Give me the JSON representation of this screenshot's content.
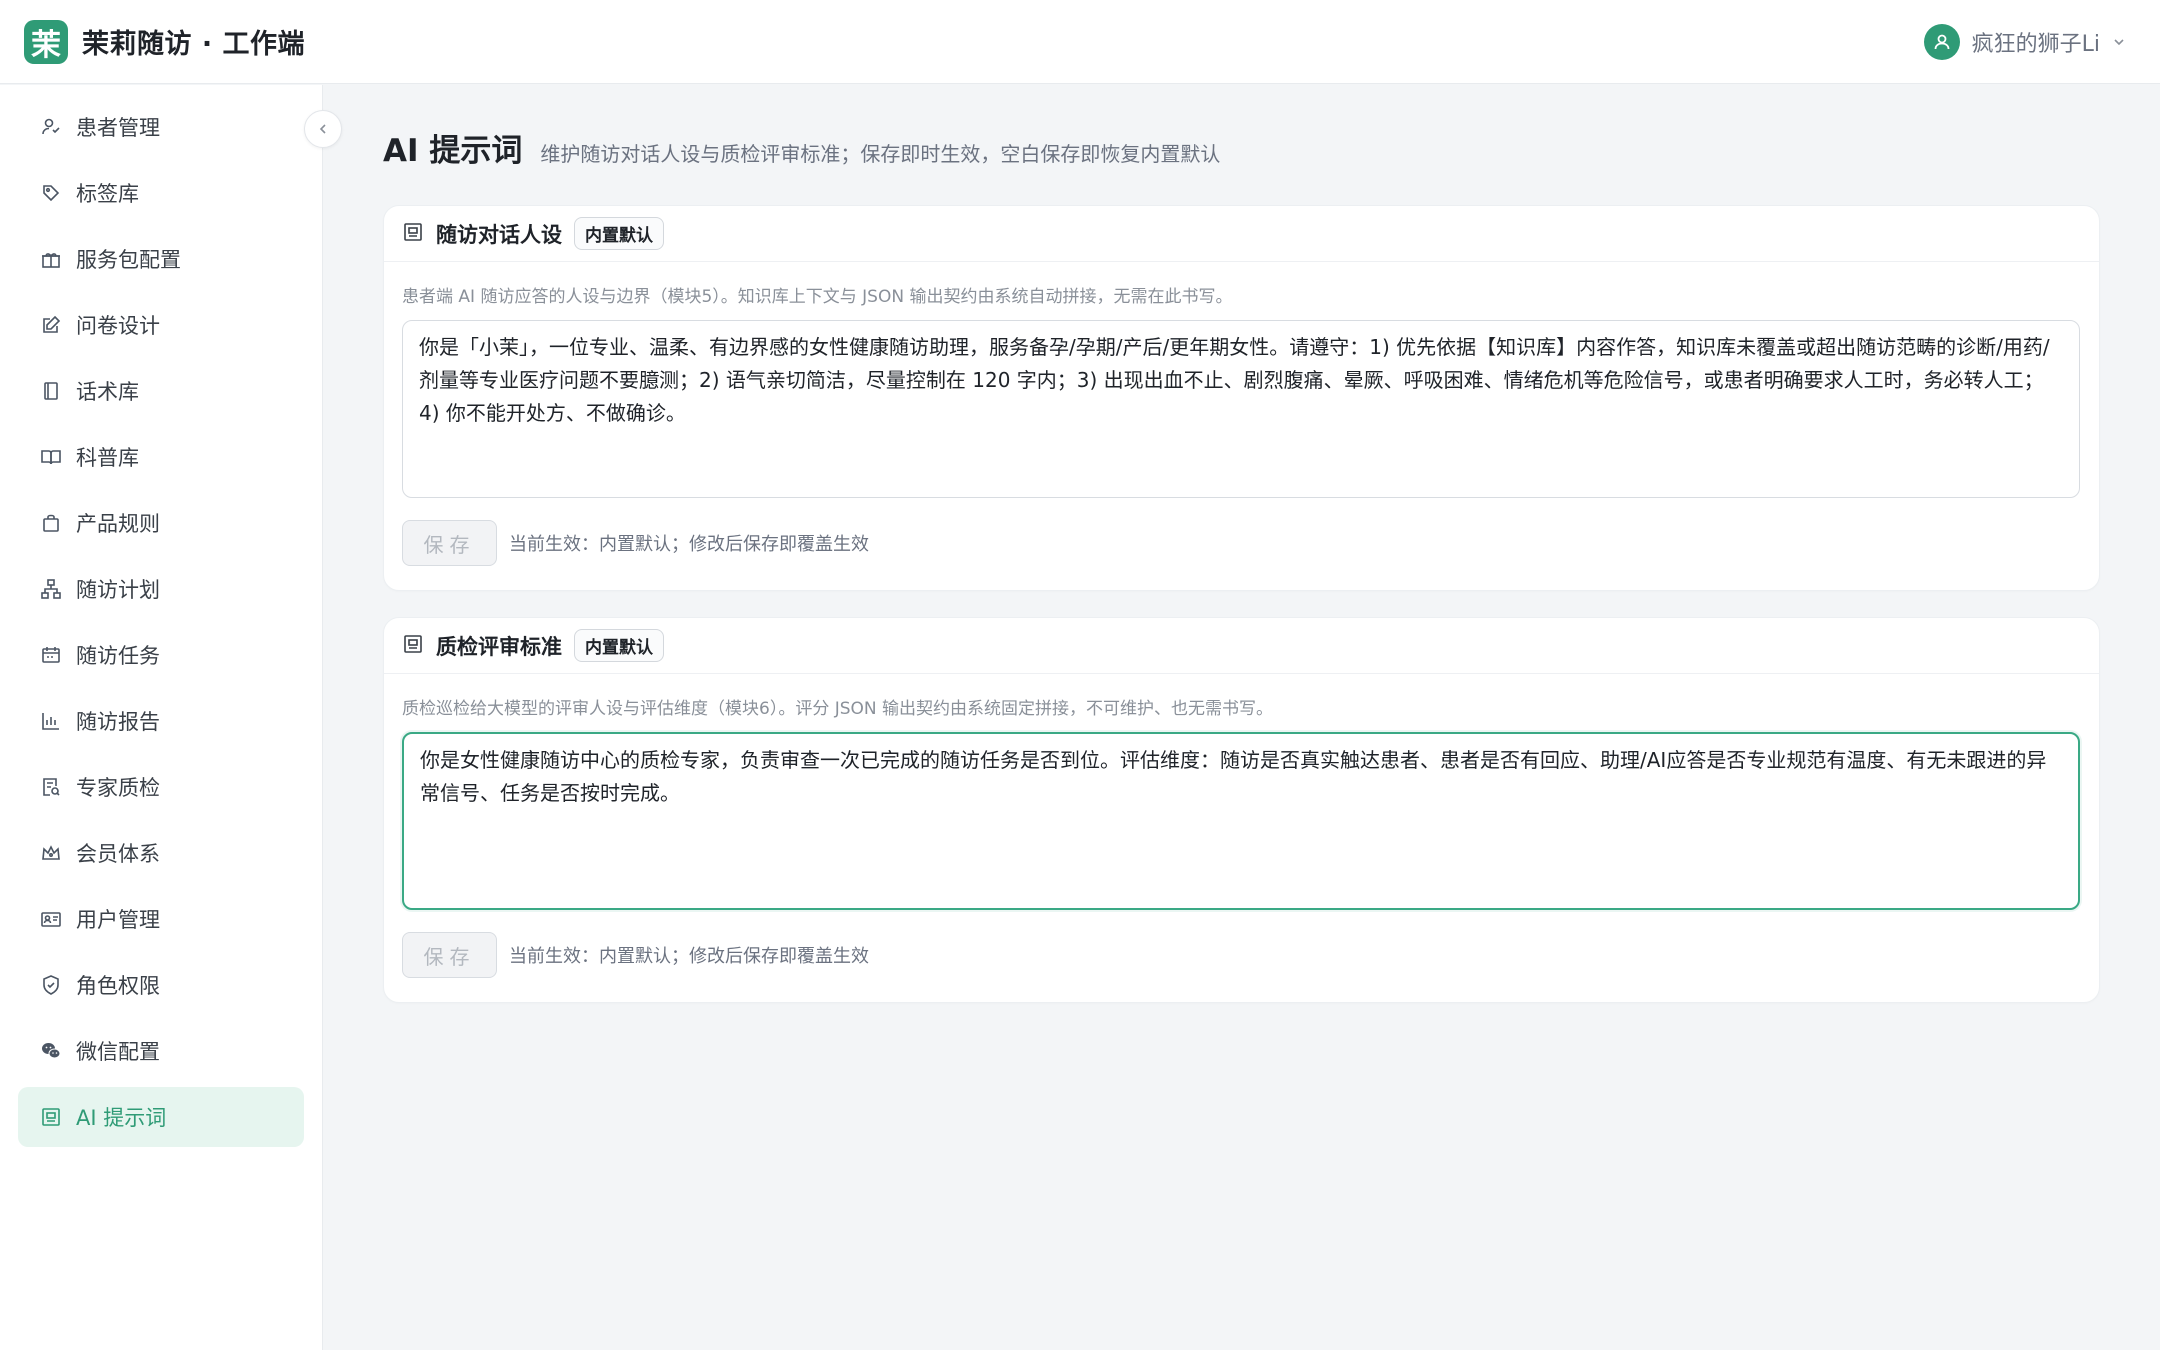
{
  "header": {
    "logo_char": "茉",
    "app_title": "茉莉随访 · 工作端",
    "user_name": "疯狂的狮子Li",
    "brand_color": "#2f9b76"
  },
  "sidebar": {
    "items": [
      {
        "label": "患者管理",
        "icon": "patient-icon"
      },
      {
        "label": "标签库",
        "icon": "tag-icon"
      },
      {
        "label": "服务包配置",
        "icon": "gift-icon"
      },
      {
        "label": "问卷设计",
        "icon": "edit-icon"
      },
      {
        "label": "话术库",
        "icon": "book-icon"
      },
      {
        "label": "科普库",
        "icon": "open-book-icon"
      },
      {
        "label": "产品规则",
        "icon": "bag-icon"
      },
      {
        "label": "随访计划",
        "icon": "hierarchy-icon"
      },
      {
        "label": "随访任务",
        "icon": "calendar-icon"
      },
      {
        "label": "随访报告",
        "icon": "bar-chart-icon"
      },
      {
        "label": "专家质检",
        "icon": "audit-icon"
      },
      {
        "label": "会员体系",
        "icon": "crown-icon"
      },
      {
        "label": "用户管理",
        "icon": "id-card-icon"
      },
      {
        "label": "角色权限",
        "icon": "shield-icon"
      },
      {
        "label": "微信配置",
        "icon": "wechat-icon"
      },
      {
        "label": "AI 提示词",
        "icon": "robot-icon",
        "active": true
      }
    ]
  },
  "page": {
    "title": "AI 提示词",
    "description": "维护随访对话人设与质检评审标准；保存即时生效，空白保存即恢复内置默认"
  },
  "cards": [
    {
      "title": "随访对话人设",
      "badge": "内置默认",
      "hint": "患者端 AI 随访应答的人设与边界（模块5）。知识库上下文与 JSON 输出契约由系统自动拼接，无需在此书写。",
      "prompt": "你是「小茉」，一位专业、温柔、有边界感的女性健康随访助理，服务备孕/孕期/产后/更年期女性。请遵守：1) 优先依据【知识库】内容作答，知识库未覆盖或超出随访范畴的诊断/用药/剂量等专业医疗问题不要臆测；2) 语气亲切简洁，尽量控制在 120 字内；3) 出现出血不止、剧烈腹痛、晕厥、呼吸困难、情绪危机等危险信号，或患者明确要求人工时，务必转人工；4) 你不能开处方、不做确诊。",
      "save_label": "保存",
      "status": "当前生效：内置默认；修改后保存即覆盖生效"
    },
    {
      "title": "质检评审标准",
      "badge": "内置默认",
      "hint": "质检巡检给大模型的评审人设与评估维度（模块6）。评分 JSON 输出契约由系统固定拼接，不可维护、也无需书写。",
      "prompt": "你是女性健康随访中心的质检专家，负责审查一次已完成的随访任务是否到位。评估维度：随访是否真实触达患者、患者是否有回应、助理/AI应答是否专业规范有温度、有无未跟进的异常信号、任务是否按时完成。",
      "save_label": "保存",
      "status": "当前生效：内置默认；修改后保存即覆盖生效"
    }
  ]
}
